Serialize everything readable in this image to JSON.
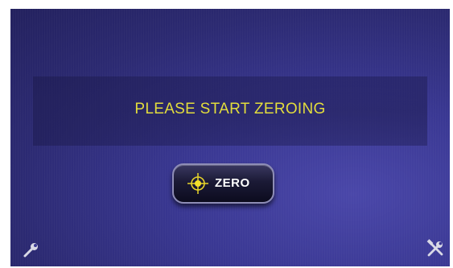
{
  "screen": {
    "message": "PLEASE START ZEROING",
    "zero_button": {
      "label": "ZERO",
      "icon": "crosshair-icon"
    },
    "bottom_left_icon": "wrench-icon",
    "bottom_right_icon": "tools-icon"
  },
  "colors": {
    "message_text": "#e3dd3c",
    "background": "#2c2a72",
    "crosshair": "#e8d52a"
  }
}
